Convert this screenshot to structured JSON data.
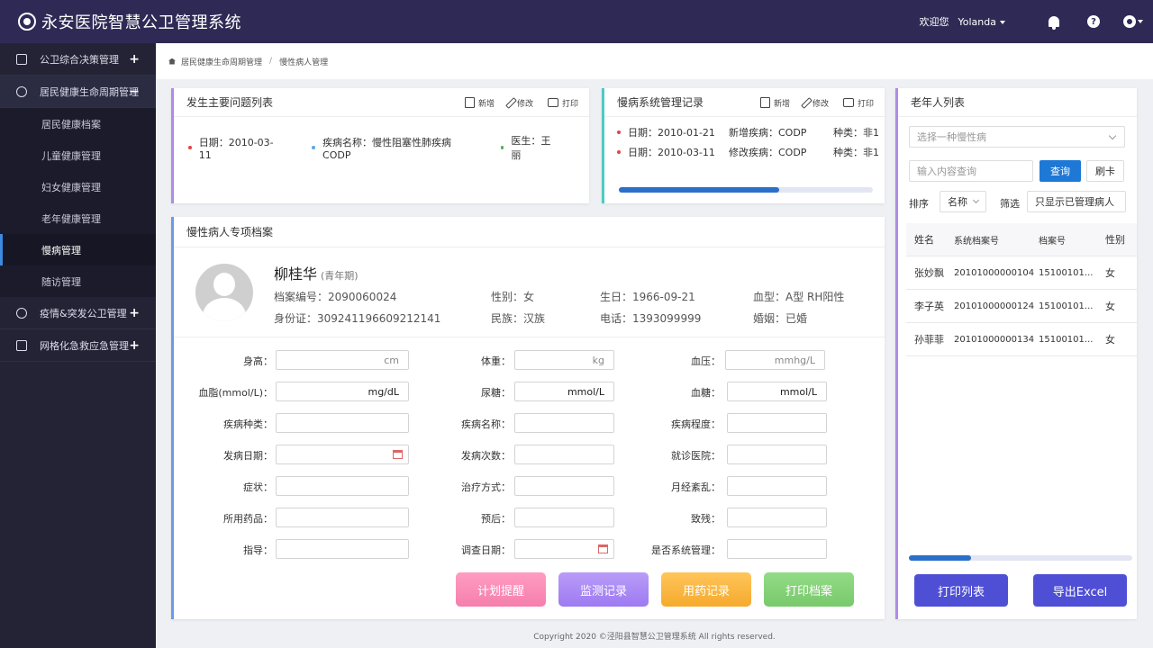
{
  "app": {
    "title": "永安医院智慧公卫管理系统",
    "welcome": "欢迎您",
    "user": "Yolanda"
  },
  "sidebar": {
    "groups": [
      {
        "label": "公卫综合决策管理",
        "toggle": "+"
      },
      {
        "label": "居民健康生命周期管理",
        "toggle": "−"
      },
      {
        "label": "疫情&突发公卫管理",
        "toggle": "+"
      },
      {
        "label": "网格化急救应急管理",
        "toggle": "+"
      }
    ],
    "subitems": [
      "居民健康档案",
      "儿童健康管理",
      "妇女健康管理",
      "老年健康管理",
      "慢病管理",
      "随访管理"
    ]
  },
  "breadcrumb": {
    "parent": "居民健康生命周期管理",
    "sep": "/",
    "current": "慢性病人管理"
  },
  "toolbar": {
    "add": "新增",
    "edit": "修改",
    "print": "打印"
  },
  "issues": {
    "title": "发生主要问题列表",
    "items": [
      {
        "text": "日期：2010-03-11",
        "color": "#e04646"
      },
      {
        "text": "疾病名称：慢性阻塞性肺疾病CODP",
        "color": "#5aa7e8"
      },
      {
        "text": "医生：王丽",
        "color": "#4caf50"
      }
    ]
  },
  "records": {
    "title": "慢病系统管理记录",
    "rows": [
      {
        "date": "日期：2010-01-21",
        "disease": "新增疾病：CODP",
        "type": "种类：非1"
      },
      {
        "date": "日期：2010-03-11",
        "disease": "修改疾病：CODP",
        "type": "种类：非1"
      }
    ],
    "progress": 0.63
  },
  "archive": {
    "title": "慢性病人专项档案",
    "patient": {
      "name": "柳桂华",
      "stage": "(青年期)",
      "file_no": "档案编号：2090060024",
      "id_no": "身份证：309241196609212141",
      "gender": "性别：女",
      "ethnic": "民族：汉族",
      "birthday": "生日：1966-09-21",
      "phone": "电话：1393099999",
      "blood": "血型：A型 RH阳性",
      "marriage": "婚姻：已婚"
    },
    "form": {
      "height": "身高：",
      "height_unit": "cm",
      "weight": "体重：",
      "weight_unit": "kg",
      "bp": "血压：",
      "bp_unit": "mmhg/L",
      "lipid": "血脂(mmol/L)：",
      "lipid_unit": "mg/dL",
      "urine": "尿糖：",
      "urine_unit": "mmol/L",
      "sugar": "血糖：",
      "sugar_unit": "mmol/L",
      "dtype": "疾病种类：",
      "dname": "疾病名称：",
      "dlevel": "疾病程度：",
      "onset": "发病日期：",
      "times": "发病次数：",
      "hospital": "就诊医院：",
      "symptom": "症状：",
      "method": "治疗方式：",
      "menses": "月经紊乱：",
      "drugs": "所用药品：",
      "prognosis": "预后：",
      "disability": "致残：",
      "guide": "指导：",
      "survey": "调查日期：",
      "managed": "是否系统管理："
    },
    "buttons": {
      "plan": "计划提醒",
      "monitor": "监测记录",
      "drug": "用药记录",
      "print": "打印档案"
    }
  },
  "elderly": {
    "title": "老年人列表",
    "select_placeholder": "选择一种慢性病",
    "search_placeholder": "输入内容查询",
    "query": "查询",
    "refresh": "刷卡",
    "sort_label": "排序",
    "sort_value": "名称",
    "filter_label": "筛选",
    "filter_value": "只显示已管理病人",
    "headers": [
      "姓名",
      "系统档案号",
      "档案号",
      "性别"
    ],
    "rows": [
      [
        "张妙飘",
        "20101000000104",
        "15100101...",
        "女"
      ],
      [
        "李子英",
        "20101000000124",
        "15100101...",
        "女"
      ],
      [
        "孙菲菲",
        "20101000000134",
        "15100101...",
        "女"
      ]
    ],
    "scroll": 0.28,
    "print_btn": "打印列表",
    "export_btn": "导出Excel"
  },
  "footer": "Copyright 2020 ©泾阳县智慧公卫管理系统 All rights reserved."
}
